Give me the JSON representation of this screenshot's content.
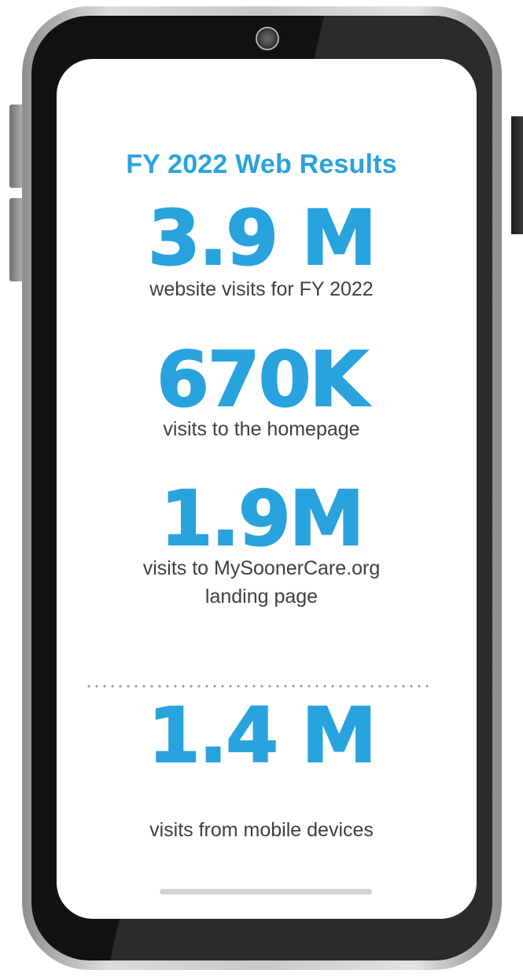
{
  "screen": {
    "title": "FY 2022 Web Results",
    "accent_color": "#29a3dd",
    "text_color": "#3f3f3f"
  },
  "stats": [
    {
      "value": "3.9 M",
      "label": "website visits for FY 2022"
    },
    {
      "value": "670K",
      "label": "visits to the homepage"
    },
    {
      "value": "1.9M",
      "label_line1": "visits to MySoonerCare.org",
      "label_line2": "landing page"
    },
    {
      "value": "1.4 M",
      "label": "visits from mobile devices"
    }
  ],
  "icons": {
    "camera": "front-camera-icon",
    "home_indicator": "home-indicator"
  }
}
